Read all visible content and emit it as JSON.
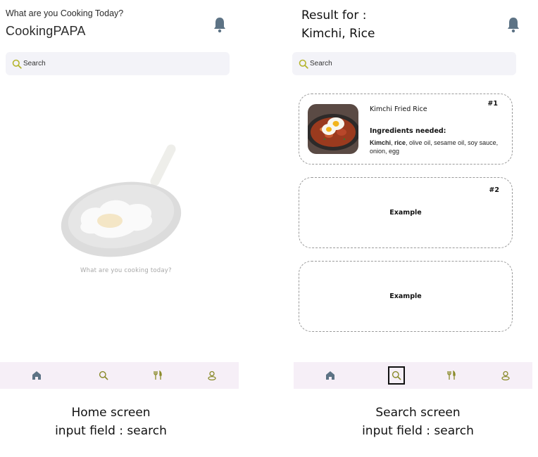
{
  "home": {
    "greeting": "What are you Cooking Today?",
    "app_name": "CookingPAPA",
    "search_placeholder": "Search",
    "empty_text": "What are you cooking today?",
    "caption_line1": "Home screen",
    "caption_line2": "input field : search"
  },
  "search_screen": {
    "result_label": "Result for :",
    "query": "Kimchi, Rice",
    "search_placeholder": "Search",
    "results": [
      {
        "rank": "#1",
        "title": "Kimchi Fried Rice",
        "ingredients_heading": "Ingredients needed:",
        "matched": [
          "Kimchi",
          "rice"
        ],
        "rest": ", olive oil, sesame oil, soy sauce, onion, egg"
      },
      {
        "rank": "#2",
        "title": "Example"
      },
      {
        "rank": "",
        "title": "Example"
      }
    ],
    "caption_line1": "Search screen",
    "caption_line2": "input field : search"
  },
  "nav": {
    "items": [
      {
        "icon": "home-icon"
      },
      {
        "icon": "search-icon"
      },
      {
        "icon": "utensils-icon"
      },
      {
        "icon": "profile-icon"
      }
    ]
  },
  "colors": {
    "nav_bg": "#f6eff7",
    "search_bg": "#f3f3f8",
    "home_icon": "#5d7385",
    "accent_olive": "#8a8a2a",
    "bell": "#5d7385"
  }
}
